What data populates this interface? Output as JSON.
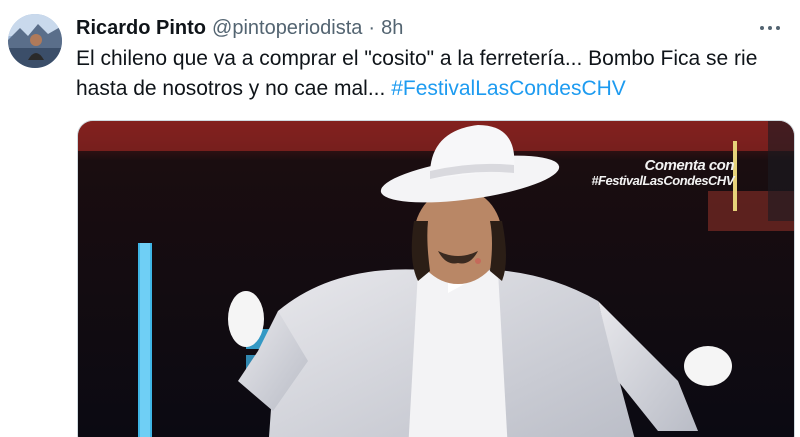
{
  "tweet": {
    "display_name": "Ricardo Pinto",
    "handle": "@pintoperiodista",
    "separator": "·",
    "time": "8h",
    "text_main": "El chileno que va a comprar el \"cosito\" a la ferretería... Bombo Fica se rie hasta de nosotros y no cae mal... ",
    "hashtag": "#FestivalLasCondesCHV"
  },
  "icons": {
    "more": "more-horizontal-icon",
    "avatar": "profile-avatar"
  },
  "media": {
    "overlay_line1": "Comenta con",
    "overlay_line2": "#FestivalLasCondesCHV"
  },
  "colors": {
    "link": "#1d9bf0",
    "text": "#0f1419",
    "secondary": "#536471"
  }
}
